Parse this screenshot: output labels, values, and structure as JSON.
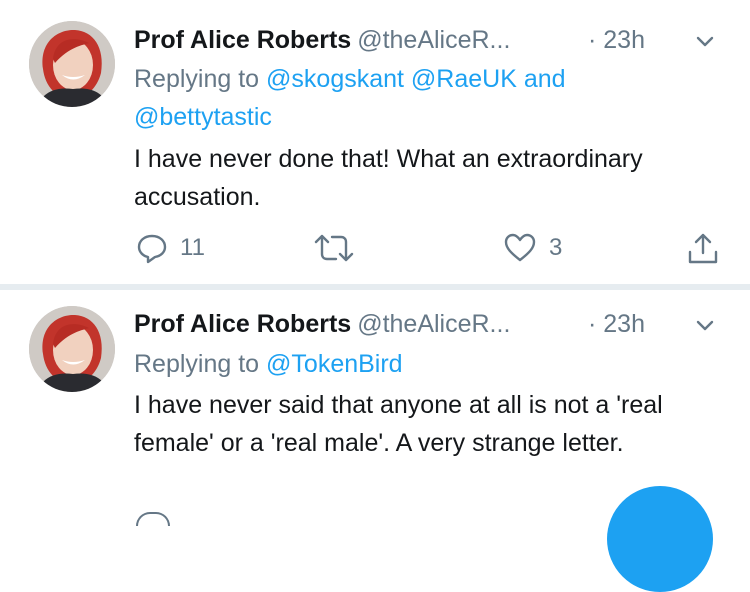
{
  "tweets": [
    {
      "name": "Prof Alice Roberts",
      "handle": "@theAliceR...",
      "time": "· 23h",
      "reply_prefix": "Replying to",
      "mentions_line1": "@skogskant @RaeUK",
      "and_word": "and",
      "mentions_line2": "@bettytastic",
      "text": "I have never done that! What an extraordinary accusation.",
      "reply_count": "11",
      "like_count": "3"
    },
    {
      "name": "Prof Alice Roberts",
      "handle": "@theAliceR...",
      "time": "· 23h",
      "reply_prefix": "Replying to",
      "mentions_line1": "@TokenBird",
      "text": "I have never said that anyone at all is not a 'real female' or a 'real male'. A very strange letter."
    }
  ],
  "icons": {
    "reply": "reply-icon",
    "retweet": "retweet-icon",
    "like": "heart-icon",
    "share": "share-icon",
    "menu": "chevron-down-icon",
    "compose": "compose-fab"
  },
  "colors": {
    "link": "#1da1f2",
    "secondary": "#657786",
    "primary_text": "#14171a",
    "divider": "#e6ecf0"
  }
}
